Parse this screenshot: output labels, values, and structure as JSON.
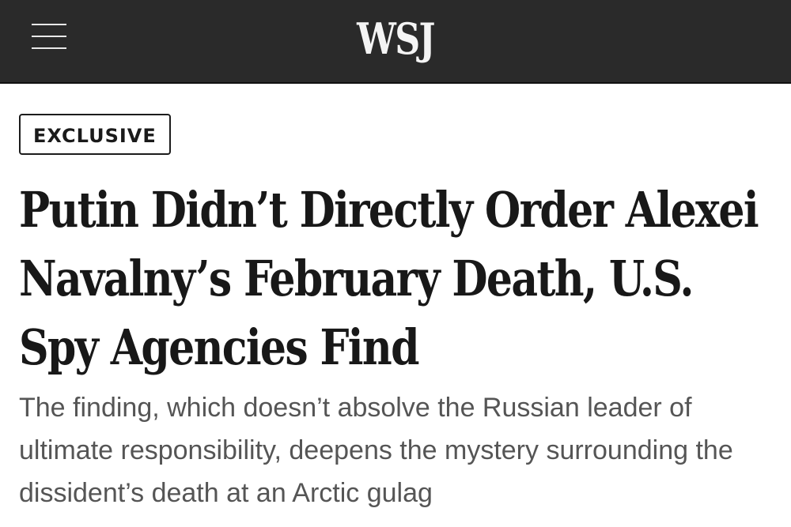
{
  "header": {
    "menu_icon": "hamburger-menu-icon",
    "logo_text": "WSJ",
    "background_color": "#2a2a2a",
    "logo_color": "#f4f4f4"
  },
  "article": {
    "badge": "EXCLUSIVE",
    "headline": "Putin Didn’t Directly Order Alexei Navalny’s February Death, U.S. Spy Agencies Find",
    "dek": "The finding, which doesn’t absolve the Russian leader of ultimate responsibility, deepens the mystery surrounding the dissident’s death at an Arctic gulag"
  }
}
